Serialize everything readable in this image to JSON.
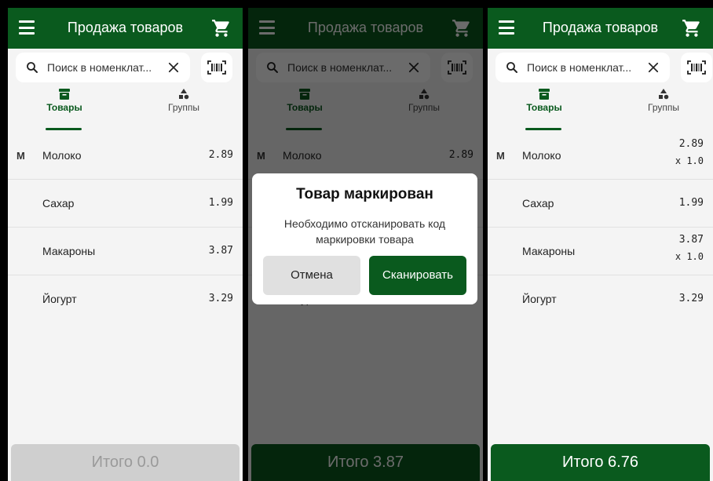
{
  "colors": {
    "primary": "#0a5a1e",
    "background": "#f4f4f4",
    "disabled_button": "#cfcfcf"
  },
  "icons": {
    "menu": "hamburger-menu-icon",
    "cart": "shopping-cart-icon",
    "search": "search-icon",
    "clear": "close-icon",
    "barcode": "barcode-scan-icon",
    "products_tab": "archive-box-icon",
    "groups_tab": "shapes-icon"
  },
  "screens": [
    {
      "title": "Продажа товаров",
      "search_placeholder": "Поиск в номенклат...",
      "tabs": [
        {
          "label": "Товары",
          "active": true
        },
        {
          "label": "Группы",
          "active": false
        }
      ],
      "items": [
        {
          "mark": "M",
          "name": "Молоко",
          "price": "2.89",
          "qty": ""
        },
        {
          "mark": "",
          "name": "Сахар",
          "price": "1.99",
          "qty": ""
        },
        {
          "mark": "",
          "name": "Макароны",
          "price": "3.87",
          "qty": ""
        },
        {
          "mark": "",
          "name": "Йогурт",
          "price": "3.29",
          "qty": ""
        }
      ],
      "total": "Итого 0.0"
    },
    {
      "title": "Продажа товаров",
      "search_placeholder": "Поиск в номенклат...",
      "tabs": [
        {
          "label": "Товары",
          "active": true
        },
        {
          "label": "Группы",
          "active": false
        }
      ],
      "items": [
        {
          "mark": "M",
          "name": "Молоко",
          "price": "2.89",
          "qty": ""
        },
        {
          "mark": "",
          "name": "Сахар",
          "price": "1.99",
          "qty": ""
        },
        {
          "mark": "",
          "name": "Макароны",
          "price": "3.87",
          "qty": ""
        },
        {
          "mark": "",
          "name": "Йогурт",
          "price": "3.29",
          "qty": ""
        }
      ],
      "total": "Итого 3.87",
      "dialog": {
        "title": "Товар маркирован",
        "message": "Необходимо отсканировать код маркировки товара",
        "cancel_label": "Отмена",
        "confirm_label": "Сканировать"
      }
    },
    {
      "title": "Продажа товаров",
      "search_placeholder": "Поиск в номенклат...",
      "tabs": [
        {
          "label": "Товары",
          "active": true
        },
        {
          "label": "Группы",
          "active": false
        }
      ],
      "items": [
        {
          "mark": "M",
          "name": "Молоко",
          "price": "2.89",
          "qty": "x 1.0"
        },
        {
          "mark": "",
          "name": "Сахар",
          "price": "1.99",
          "qty": ""
        },
        {
          "mark": "",
          "name": "Макароны",
          "price": "3.87",
          "qty": "x 1.0"
        },
        {
          "mark": "",
          "name": "Йогурт",
          "price": "3.29",
          "qty": ""
        }
      ],
      "total": "Итого 6.76"
    }
  ]
}
